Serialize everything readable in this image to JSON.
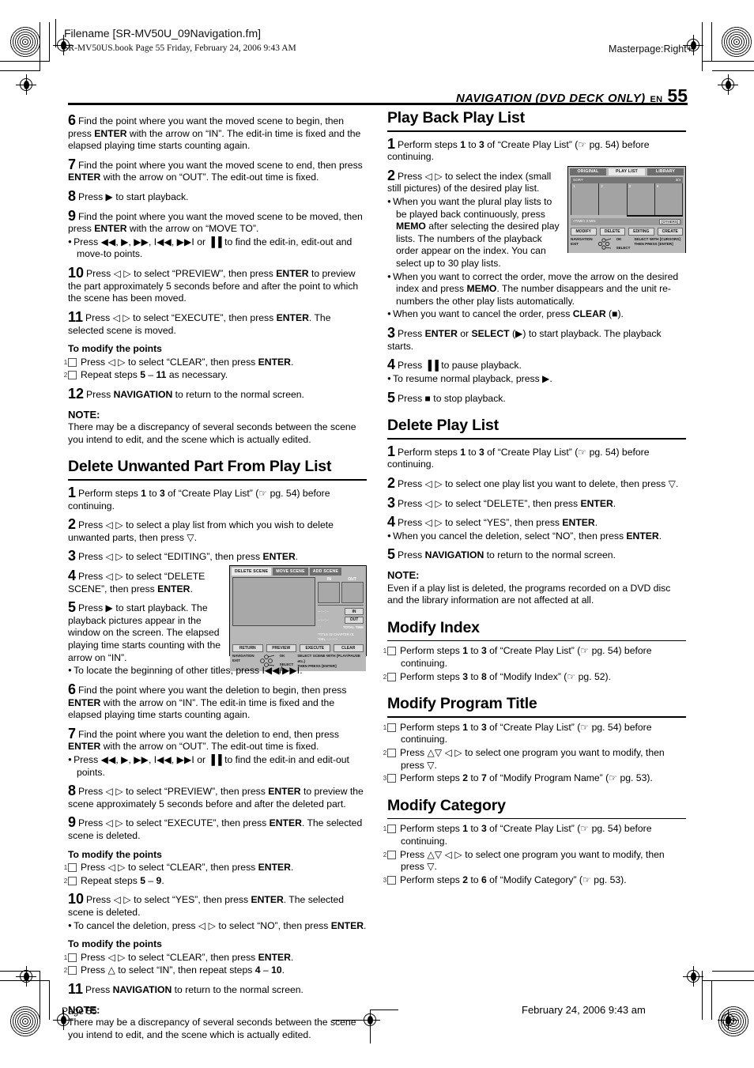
{
  "page": {
    "filename_label": "Filename [SR-MV50U_09Navigation.fm]",
    "book_line": "SR-MV50US.book  Page 55  Friday, February 24, 2006  9:43 AM",
    "masterpage": "Masterpage:Right+",
    "running_head": "NAVIGATION (DVD DECK ONLY)",
    "en_label": "EN",
    "page_number": "55",
    "footer_page": "Page 55",
    "footer_date": "February 24, 2006 9:43 am"
  },
  "left_column": {
    "steps_move": [
      {
        "num": "6",
        "text_html": "Find the point where you want the moved scene to begin, then press <b>ENTER</b> with the arrow on “IN”. The edit-in time is fixed and the elapsed playing time starts counting again."
      },
      {
        "num": "7",
        "text_html": "Find the point where you want the moved scene to end, then press <b>ENTER</b> with the arrow on “OUT”. The edit-out time is fixed."
      },
      {
        "num": "8",
        "text_html": "Press ▶ to start playback."
      },
      {
        "num": "9",
        "text_html": "Find the point where you want the moved scene to be moved, then press <b>ENTER</b> with the arrow on “MOVE TO”."
      }
    ],
    "bullet_move": "Press ◀◀, ▶, ▶▶, I◀◀, ▶▶I or ▐▐ to find the edit-in, edit-out and move-to points.",
    "steps_move2": [
      {
        "num": "10",
        "text_html": "Press ◁ ▷ to select “PREVIEW”, then press <b>ENTER</b> to preview the part approximately 5 seconds before and after the point to which the scene has been moved."
      },
      {
        "num": "11",
        "text_html": "Press ◁ ▷ to select “EXECUTE”, then press <b>ENTER</b>. The selected scene is moved."
      }
    ],
    "modify_points_1": {
      "heading": "To modify the points",
      "items_html": [
        "Press ◁ ▷ to select “CLEAR”, then press <b>ENTER</b>.",
        "Repeat steps <b>5</b> – <b>11</b> as necessary."
      ]
    },
    "step_12": {
      "num": "12",
      "text_html": "Press <b>NAVIGATION</b> to return to the normal screen."
    },
    "note_1": {
      "heading": "NOTE:",
      "body": "There may be a discrepancy of several seconds between the scene you intend to edit, and the scene which is actually edited."
    },
    "section_delete_part": {
      "title": "Delete Unwanted Part From Play List",
      "steps": [
        {
          "num": "1",
          "text_html": "Perform steps <b>1</b> to <b>3</b> of “Create Play List” (☞ pg. 54) before continuing."
        },
        {
          "num": "2",
          "text_html": "Press ◁ ▷ to select a play list from which you wish to delete unwanted parts, then press ▽."
        },
        {
          "num": "3",
          "text_html": "Press ◁ ▷ to select “EDITING”, then press <b>ENTER</b>."
        },
        {
          "num": "4",
          "text_html": "Press ◁ ▷ to select “DELETE SCENE”, then press <b>ENTER</b>."
        },
        {
          "num": "5",
          "text_html": "Press ▶ to start playback. The playback pictures appear in the window on the screen. The elapsed playing time starts counting with the arrow on “IN”."
        }
      ],
      "bullet_5": "To locate the beginning of other titles, press I◀◀/▶▶I.",
      "steps_cont": [
        {
          "num": "6",
          "text_html": "Find the point where you want the deletion to begin, then press <b>ENTER</b> with the arrow on “IN”. The edit-in time is fixed and the elapsed playing time starts counting again."
        },
        {
          "num": "7",
          "text_html": "Find the point where you want the deletion to end, then press <b>ENTER</b> with the arrow on “OUT”. The edit-out time is fixed."
        }
      ],
      "bullet_7": "Press ◀◀, ▶, ▶▶, I◀◀, ▶▶I or ▐▐ to find the edit-in and edit-out points.",
      "steps_cont2": [
        {
          "num": "8",
          "text_html": "Press ◁ ▷ to select “PREVIEW”, then press <b>ENTER</b> to preview the scene approximately 5 seconds before and after the deleted part."
        },
        {
          "num": "9",
          "text_html": "Press ◁ ▷ to select “EXECUTE”, then press <b>ENTER</b>. The selected scene is deleted."
        }
      ],
      "modify_points_2": {
        "heading": "To modify the points",
        "items_html": [
          "Press ◁ ▷ to select “CLEAR”, then press <b>ENTER</b>.",
          "Repeat steps <b>5</b> – <b>9</b>."
        ]
      },
      "step_10": {
        "num": "10",
        "text_html": "Press ◁ ▷ to select “YES”, then press <b>ENTER</b>. The selected scene is deleted."
      },
      "bullet_10": "To cancel the deletion, press ◁ ▷ to select “NO”, then press <b>ENTER</b>.",
      "modify_points_3": {
        "heading": "To modify the points",
        "items_html": [
          "Press ◁ ▷ to select “CLEAR”, then press <b>ENTER</b>.",
          "Press △ to select “IN”, then repeat steps <b>4</b> – <b>10</b>."
        ]
      },
      "step_11": {
        "num": "11",
        "text_html": "Press <b>NAVIGATION</b> to return to the normal screen."
      },
      "note_2": {
        "heading": "NOTE:",
        "body": "There may be a discrepancy of several seconds between the scene you intend to edit, and the scene which is actually edited."
      }
    }
  },
  "right_column": {
    "section_playback": {
      "title": "Play Back Play List",
      "steps": [
        {
          "num": "1",
          "text_html": "Perform steps <b>1</b> to <b>3</b> of “Create Play List” (☞ pg. 54) before continuing."
        },
        {
          "num": "2",
          "text_html": "Press ◁ ▷ to select the index (small still pictures) of the desired play list."
        }
      ],
      "bullets_html": [
        "When you want the plural play lists to be played back continuously, press <b>MEMO</b> after selecting the desired play lists. The numbers of the playback order appear on the index. You can select up to 30 play lists.",
        "When you want to correct the order, move the arrow on the desired index and press <b>MEMO</b>. The number disappears and the unit re-numbers the other play lists automatically.",
        "When you want to cancel the order, press <b>CLEAR</b> (■)."
      ],
      "steps_cont": [
        {
          "num": "3",
          "text_html": "Press <b>ENTER</b> or <b>SELECT</b> (▶) to start playback. The playback starts."
        },
        {
          "num": "4",
          "text_html": "Press ▐▐ to pause playback."
        }
      ],
      "bullet_4": "To resume normal playback, press ▶.",
      "step_5": {
        "num": "5",
        "text_html": "Press ■ to stop playback."
      }
    },
    "section_delete_playlist": {
      "title": "Delete Play List",
      "steps": [
        {
          "num": "1",
          "text_html": "Perform steps <b>1</b> to <b>3</b> of “Create Play List” (☞ pg. 54) before continuing."
        },
        {
          "num": "2",
          "text_html": "Press ◁ ▷ to select one play list you want to delete, then press ▽."
        },
        {
          "num": "3",
          "text_html": "Press ◁ ▷ to select “DELETE”, then press <b>ENTER</b>."
        },
        {
          "num": "4",
          "text_html": "Press ◁ ▷ to select “YES”, then press <b>ENTER</b>."
        }
      ],
      "bullet_4": "When you cancel the deletion, select “NO”, then press <b>ENTER</b>.",
      "step_5": {
        "num": "5",
        "text_html": "Press <b>NAVIGATION</b> to return to the normal screen."
      },
      "note": {
        "heading": "NOTE:",
        "body": "Even if a play list is deleted, the programs recorded on a DVD disc and the library information are not affected at all."
      }
    },
    "section_modify_index": {
      "title": "Modify Index",
      "items_html": [
        "Perform steps <b>1</b> to <b>3</b> of “Create Play List” (☞ pg. 54) before continuing.",
        "Perform steps <b>3</b> to <b>8</b> of “Modify Index” (☞ pg. 52)."
      ]
    },
    "section_modify_program_title": {
      "title": "Modify Program Title",
      "items_html": [
        "Perform steps <b>1</b> to <b>3</b> of “Create Play List” (☞ pg. 54) before continuing.",
        "Press △▽ ◁ ▷ to select one program you want to modify, then press ▽.",
        "Perform steps <b>2</b> to <b>7</b> of “Modify Program Name” (☞ pg. 53)."
      ]
    },
    "section_modify_category": {
      "title": "Modify Category",
      "items_html": [
        "Perform steps <b>1</b> to <b>3</b> of “Create Play List” (☞ pg. 54) before continuing.",
        "Press △▽ ◁ ▷ to select one program you want to modify, then press ▽.",
        "Perform steps <b>2</b> to <b>6</b> of “Modify Category” (☞ pg. 53)."
      ]
    }
  },
  "figure_delete_scene": {
    "tabs": [
      "DELETE SCENE",
      "MOVE SCENE",
      "ADD SCENE"
    ],
    "selected_tab": "DELETE SCENE",
    "inout_headers": [
      "IN",
      "OUT"
    ],
    "time_rows": [
      {
        "value": "--:--:--",
        "label": "IN"
      },
      {
        "value": "--:--:--",
        "label": "OUT"
      },
      {
        "value": ": :",
        "label": "TOTAL TIME"
      }
    ],
    "chapter_info_1": "*TITLE 02 CHAPTER 01",
    "chapter_info_2": "*DEL --:--:--:--",
    "buttons": [
      "RETURN",
      "PREVIEW",
      "EXECUTE",
      "CLEAR"
    ],
    "foot_nav": "NAVIGATION",
    "foot_exit": "EXIT",
    "foot_ok": "OK",
    "foot_select": "SELECT",
    "guide_line1": "SELECT SCENE WITH [PLAY/PAUSE etc.]",
    "guide_line2": "THEN PRESS [ENTER]"
  },
  "figure_play_list": {
    "tabs": [
      "ORIGINAL",
      "PLAY LIST",
      "LIBRARY"
    ],
    "selected_tab": "PLAY LIST",
    "sort_label": "SORT",
    "page_indicator": "3/4",
    "cells": [
      "1",
      "2",
      "3",
      "4"
    ],
    "info_label": "<TIME> 0 MIN",
    "others_button": "[OTHERS]",
    "buttons": [
      "MODIFY",
      "DELETE",
      "EDITING",
      "CREATE"
    ],
    "foot_nav": "NAVIGATION",
    "foot_exit": "EXIT",
    "foot_ok": "OK",
    "foot_select": "SELECT",
    "guide_line1": "SELECT WITH [CURSORS]",
    "guide_line2": "THEN PRESS [ENTER]"
  }
}
